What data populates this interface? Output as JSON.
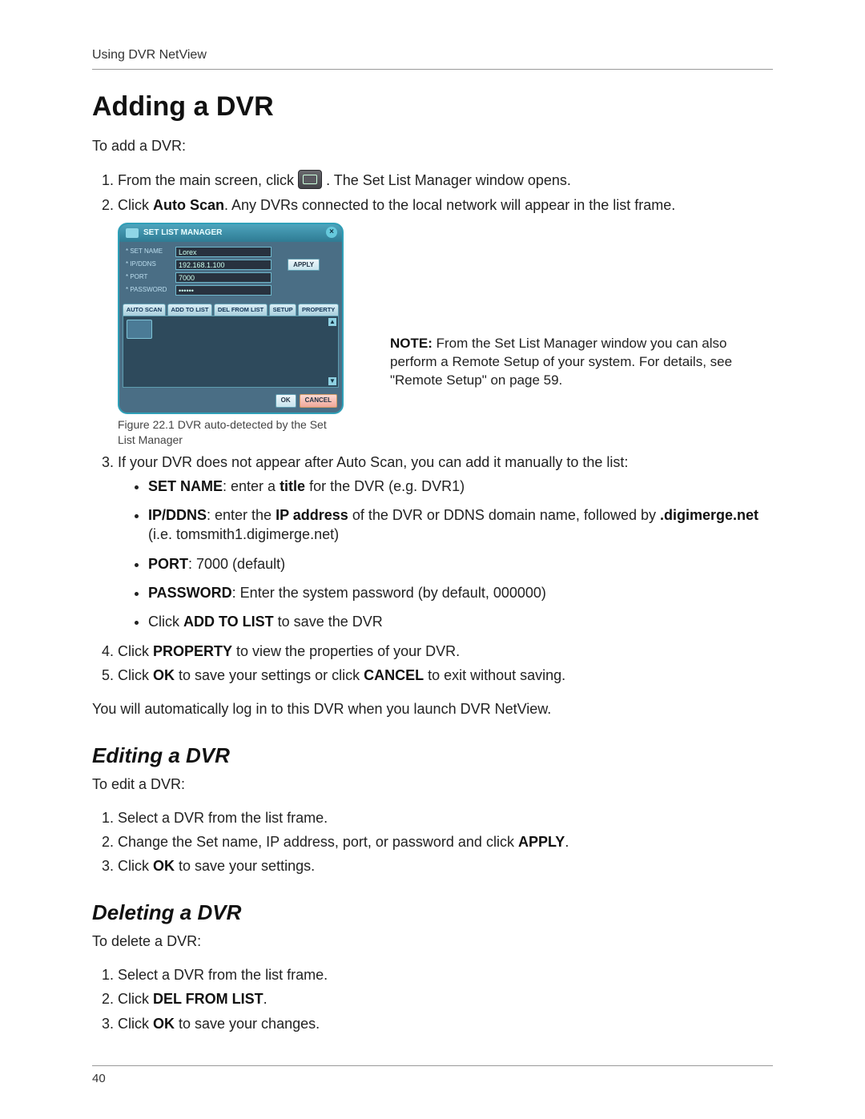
{
  "header": {
    "running": "Using DVR NetView"
  },
  "titles": {
    "add": "Adding a DVR",
    "edit": "Editing a DVR",
    "del": "Deleting a DVR"
  },
  "add": {
    "intro": "To add a DVR:",
    "step1_a": "From the main screen, click ",
    "step1_b": ". The Set List Manager window opens.",
    "step2_a": "Click ",
    "step2_bold": "Auto Scan",
    "step2_b": ". Any DVRs connected to the local network will appear in the list frame.",
    "figure_caption": "Figure 22.1 DVR auto-detected by the Set List Manager",
    "note_bold": "NOTE:",
    "note_text": " From the Set List Manager window you can also perform a Remote Setup of your system. For details, see \"Remote Setup\" on page 59.",
    "step3_intro": "If your DVR does not appear after Auto Scan, you can add it manually to the list:",
    "b_setname_bold": "SET NAME",
    "b_setname_a": ": enter a ",
    "b_setname_title": "title",
    "b_setname_b": " for the DVR (e.g. DVR1)",
    "b_ip_bold": "IP/DDNS",
    "b_ip_a": ": enter the ",
    "b_ip_addr": "IP address",
    "b_ip_b": " of the DVR or DDNS domain name, followed by ",
    "b_ip_domain": ".digimerge.net",
    "b_ip_c": " (i.e. tomsmith1.digimerge.net)",
    "b_port_bold": "PORT",
    "b_port_txt": ": 7000 (default)",
    "b_pass_bold": "PASSWORD",
    "b_pass_txt": ": Enter the system password (by default, 000000)",
    "b_addlist_a": "Click ",
    "b_addlist_bold": "ADD TO LIST",
    "b_addlist_b": " to save the DVR",
    "step4_a": "Click ",
    "step4_bold": "PROPERTY",
    "step4_b": " to view the properties of your DVR.",
    "step5_a": "Click ",
    "step5_bold1": "OK",
    "step5_b": " to save your settings or click ",
    "step5_bold2": "CANCEL",
    "step5_c": " to exit without saving.",
    "closing": "You will automatically log in to this DVR when you launch DVR NetView."
  },
  "edit": {
    "intro": "To edit a DVR:",
    "s1": "Select a DVR from the list frame.",
    "s2_a": "Change the Set name, IP address, port, or password and click ",
    "s2_bold": "APPLY",
    "s2_b": ".",
    "s3_a": "Click ",
    "s3_bold": "OK",
    "s3_b": " to save your settings."
  },
  "del": {
    "intro": "To delete a DVR:",
    "s1": "Select a DVR from the list frame.",
    "s2_a": "Click ",
    "s2_bold": "DEL FROM LIST",
    "s2_b": ".",
    "s3_a": "Click ",
    "s3_bold": "OK",
    "s3_b": " to save your changes."
  },
  "slm": {
    "title": "SET LIST MANAGER",
    "labels": {
      "setname": "* SET NAME",
      "ipddns": "* IP/DDNS",
      "port": "* PORT",
      "password": "* PASSWORD"
    },
    "values": {
      "setname": "Lorex",
      "ipddns": "192.168.1.100",
      "port": "7000",
      "password": "••••••"
    },
    "apply": "APPLY",
    "tabs": {
      "autoscan": "AUTO SCAN",
      "addtolist": "ADD TO LIST",
      "delfromlist": "DEL FROM LIST",
      "setup": "SETUP",
      "property": "PROPERTY"
    },
    "ok": "OK",
    "cancel": "CANCEL"
  },
  "page_number": "40"
}
